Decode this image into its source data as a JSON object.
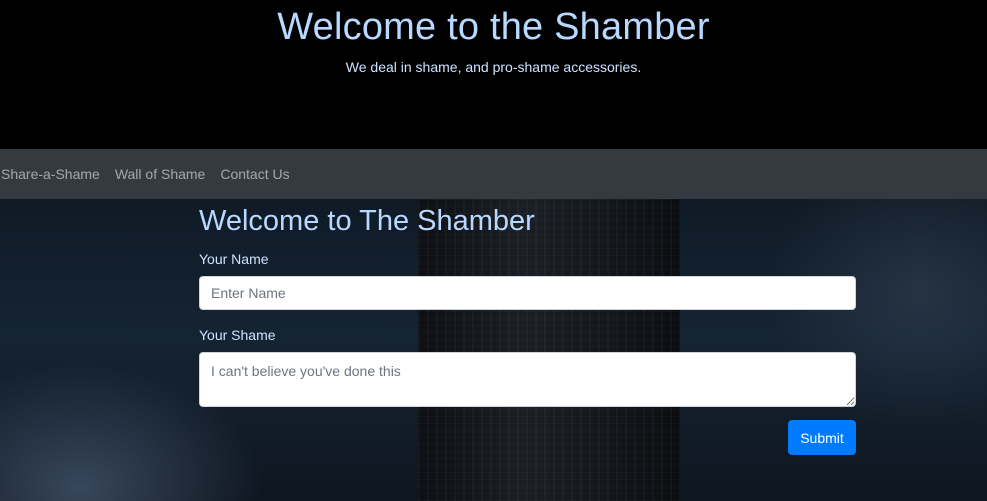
{
  "hero": {
    "title": "Welcome to the Shamber",
    "subtitle": "We deal in shame, and pro-shame accessories."
  },
  "nav": {
    "items": [
      {
        "label": "Share-a-Shame"
      },
      {
        "label": "Wall of Shame"
      },
      {
        "label": "Contact Us"
      }
    ]
  },
  "form": {
    "title": "Welcome to The Shamber",
    "name_label": "Your Name",
    "name_placeholder": "Enter Name",
    "name_value": "",
    "shame_label": "Your Shame",
    "shame_placeholder": "I can't believe you've done this",
    "shame_value": "",
    "submit_label": "Submit"
  },
  "colors": {
    "heading": "#b8d8ff",
    "navbar_bg": "#343a40",
    "button_primary": "#007bff"
  }
}
